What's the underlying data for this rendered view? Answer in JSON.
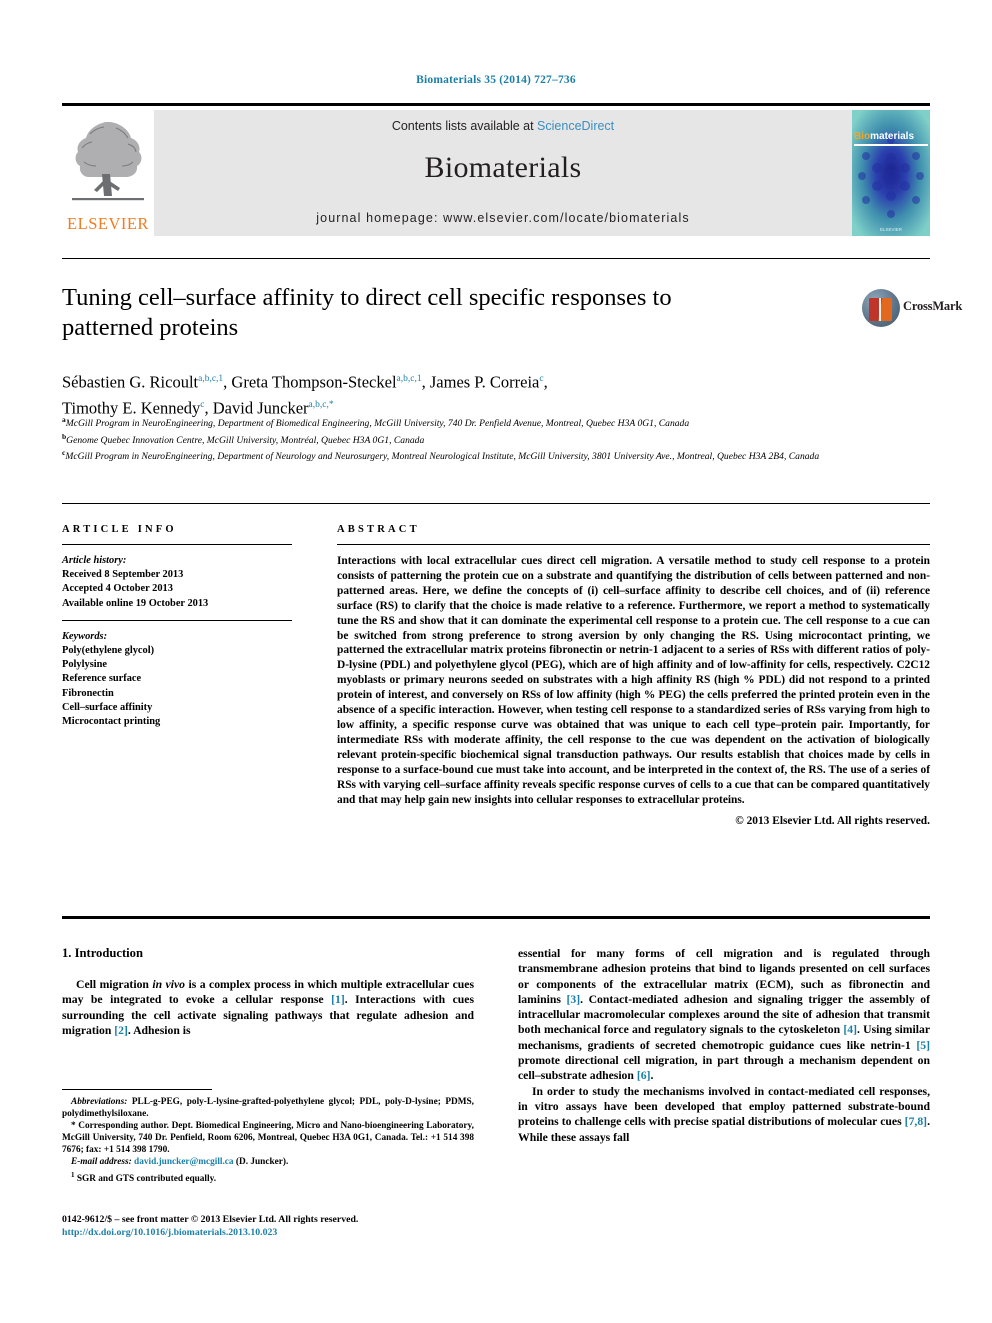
{
  "running_head": "Biomaterials 35 (2014) 727–736",
  "masthead": {
    "publisher_wordmark": "ELSEVIER",
    "contents_prefix": "Contents lists available at ",
    "contents_link": "ScienceDirect",
    "journal_name": "Biomaterials",
    "homepage": "journal homepage: www.elsevier.com/locate/biomaterials",
    "cover_title_prefix": "Bio",
    "cover_title_rest": "materials",
    "cover_footer": "ELSEVIER"
  },
  "article": {
    "title": "Tuning cell–surface affinity to direct cell specific responses to patterned proteins",
    "authors_line_1_a": "Sébastien G. Ricoult",
    "authors_line_1_a_sup": "a,b,c,1",
    "authors_line_1_b": ", Greta Thompson-Steckel",
    "authors_line_1_b_sup": "a,b,c,1",
    "authors_line_1_c": ", James P. Correia",
    "authors_line_1_c_sup": "c",
    "authors_line_2_a": "Timothy E. Kennedy",
    "authors_line_2_a_sup": "c",
    "authors_line_2_b": ", David Juncker",
    "authors_line_2_b_sup": "a,b,c,*",
    "affiliations": [
      {
        "marker": "a",
        "text": "McGill Program in NeuroEngineering, Department of Biomedical Engineering, McGill University, 740 Dr. Penfield Avenue, Montreal, Quebec H3A 0G1, Canada"
      },
      {
        "marker": "b",
        "text": "Genome Quebec Innovation Centre, McGill University, Montréal, Quebec H3A 0G1, Canada"
      },
      {
        "marker": "c",
        "text": "McGill Program in NeuroEngineering, Department of Neurology and Neurosurgery, Montreal Neurological Institute, McGill University, 3801 University Ave., Montreal, Quebec H3A 2B4, Canada"
      }
    ],
    "crossmark_label": "CrossMark"
  },
  "article_info": {
    "heading": "ARTICLE INFO",
    "history_label": "Article history:",
    "history": [
      "Received 8 September 2013",
      "Accepted 4 October 2013",
      "Available online 19 October 2013"
    ],
    "keywords_label": "Keywords:",
    "keywords": [
      "Poly(ethylene glycol)",
      "Polylysine",
      "Reference surface",
      "Fibronectin",
      "Cell–surface affinity",
      "Microcontact printing"
    ]
  },
  "abstract": {
    "heading": "ABSTRACT",
    "body": "Interactions with local extracellular cues direct cell migration. A versatile method to study cell response to a protein consists of patterning the protein cue on a substrate and quantifying the distribution of cells between patterned and non-patterned areas. Here, we define the concepts of (i) cell–surface affinity to describe cell choices, and of (ii) reference surface (RS) to clarify that the choice is made relative to a reference. Furthermore, we report a method to systematically tune the RS and show that it can dominate the experimental cell response to a protein cue. The cell response to a cue can be switched from strong preference to strong aversion by only changing the RS. Using microcontact printing, we patterned the extracellular matrix proteins fibronectin or netrin-1 adjacent to a series of RSs with different ratios of poly-D-lysine (PDL) and polyethylene glycol (PEG), which are of high affinity and of low-affinity for cells, respectively. C2C12 myoblasts or primary neurons seeded on substrates with a high affinity RS (high % PDL) did not respond to a printed protein of interest, and conversely on RSs of low affinity (high % PEG) the cells preferred the printed protein even in the absence of a specific interaction. However, when testing cell response to a standardized series of RSs varying from high to low affinity, a specific response curve was obtained that was unique to each cell type–protein pair. Importantly, for intermediate RSs with moderate affinity, the cell response to the cue was dependent on the activation of biologically relevant protein-specific biochemical signal transduction pathways. Our results establish that choices made by cells in response to a surface-bound cue must take into account, and be interpreted in the context of, the RS. The use of a series of RSs with varying cell–surface affinity reveals specific response curves of cells to a cue that can be compared quantitatively and that may help gain new insights into cellular responses to extracellular proteins.",
    "copyright": "© 2013 Elsevier Ltd. All rights reserved."
  },
  "body": {
    "section_number_title": "1.  Introduction",
    "left_para_1_p1": "Cell migration ",
    "left_para_1_ital": "in vivo",
    "left_para_1_p2": " is a complex process in which multiple extracellular cues may be integrated to evoke a cellular response ",
    "left_para_1_cite1": "[1]",
    "left_para_1_p3": ". Interactions with cues surrounding the cell activate signaling pathways that regulate adhesion and migration ",
    "left_para_1_cite2": "[2]",
    "left_para_1_p4": ". Adhesion is",
    "right_para_1_p1": "essential for many forms of cell migration and is regulated through transmembrane adhesion proteins that bind to ligands presented on cell surfaces or components of the extracellular matrix (ECM), such as fibronectin and laminins ",
    "right_para_1_cite1": "[3]",
    "right_para_1_p2": ". Contact-mediated adhesion and signaling trigger the assembly of intracellular macromolecular complexes around the site of adhesion that transmit both mechanical force and regulatory signals to the cytoskeleton ",
    "right_para_1_cite2": "[4]",
    "right_para_1_p3": ". Using similar mechanisms, gradients of secreted chemotropic guidance cues like netrin-1 ",
    "right_para_1_cite3": "[5]",
    "right_para_1_p4": " promote directional cell migration, in part through a mechanism dependent on cell–substrate adhesion ",
    "right_para_1_cite4": "[6]",
    "right_para_1_p5": ".",
    "right_para_2_p1": "In order to study the mechanisms involved in contact-mediated cell responses, in vitro assays have been developed that employ patterned substrate-bound proteins to challenge cells with precise spatial distributions of molecular cues ",
    "right_para_2_cite1": "[7,8]",
    "right_para_2_p2": ". While these assays fall"
  },
  "footnotes": {
    "abbrev_label": "Abbreviations:",
    "abbrev_text": " PLL-g-PEG, poly-L-lysine-grafted-polyethylene glycol; PDL, poly-D-lysine; PDMS, polydimethylsiloxane.",
    "corresponding": "* Corresponding author. Dept. Biomedical Engineering, Micro and Nano-bioengineering Laboratory, McGill University, 740 Dr. Penfield, Room 6206, Montreal, Quebec H3A 0G1, Canada. Tel.: +1 514 398 7676; fax: +1 514 398 1790.",
    "email_label": "E-mail address:",
    "email": "david.juncker@mcgill.ca",
    "email_suffix": " (D. Juncker).",
    "contrib_marker": "1",
    "contrib_text": " SGR and GTS contributed equally."
  },
  "footer": {
    "issn_line": "0142-9612/$ – see front matter © 2013 Elsevier Ltd. All rights reserved.",
    "doi": "http://dx.doi.org/10.1016/j.biomaterials.2013.10.023"
  },
  "colors": {
    "link": "#1a7fa8",
    "elsevier_orange": "#F27C21",
    "masthead_bg": "#e6e6e6",
    "sciencedirect": "#3a8fc0"
  }
}
